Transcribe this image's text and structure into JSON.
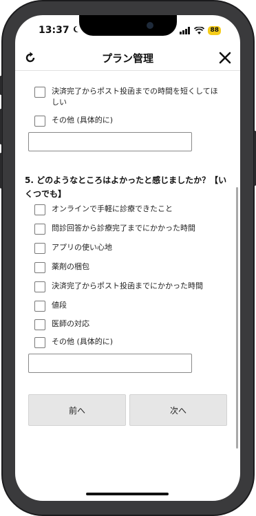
{
  "status_bar": {
    "time": "13:37",
    "battery": "88"
  },
  "header": {
    "title": "プラン管理"
  },
  "top_options": [
    {
      "label": "決済完了からポスト投函までの時間を短くしてほしい"
    },
    {
      "label": "その他 (具体的に)"
    }
  ],
  "question5": {
    "title": "5. どのようなところはよかったと感じましたか？【いくつでも】",
    "options": [
      {
        "label": "オンラインで手軽に診療できたこと"
      },
      {
        "label": "問診回答から診療完了までにかかった時間"
      },
      {
        "label": "アプリの使い心地"
      },
      {
        "label": "薬剤の梱包"
      },
      {
        "label": "決済完了からポスト投函までにかかった時間"
      },
      {
        "label": "値段"
      },
      {
        "label": "医師の対応"
      },
      {
        "label": "その他 (具体的に)"
      }
    ]
  },
  "buttons": {
    "prev": "前へ",
    "next": "次へ"
  }
}
